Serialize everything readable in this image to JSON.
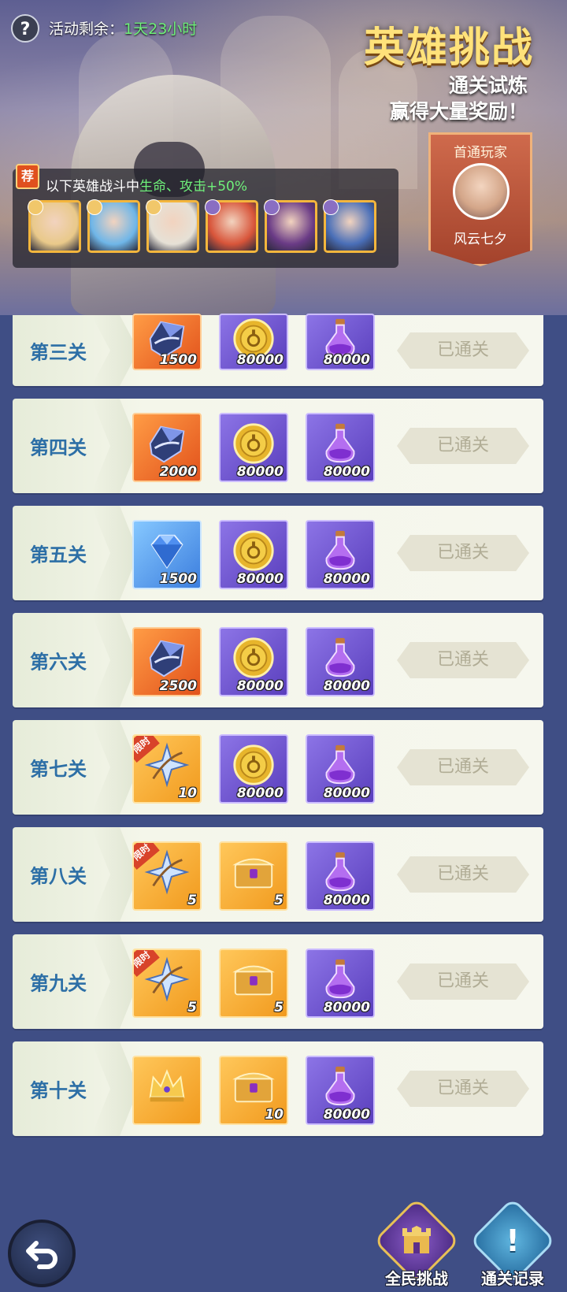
{
  "header": {
    "help_symbol": "?",
    "timer_label": "活动剩余：",
    "timer_value": "1天23小时",
    "title": "英雄挑战",
    "subtitle_line1": "通关试炼",
    "subtitle_line2": "赢得大量奖励！"
  },
  "first_clear": {
    "title": "首通玩家",
    "player_name": "风云七夕"
  },
  "buff": {
    "tag": "荐",
    "text_prefix": "以下英雄战斗中",
    "text_stat": "生命、攻击+50%",
    "heroes": [
      {
        "name": "hero-portrait-1",
        "tone": "#e9c98a"
      },
      {
        "name": "hero-portrait-2",
        "tone": "#6fb6e8"
      },
      {
        "name": "hero-portrait-3",
        "tone": "#e6e1d6"
      },
      {
        "name": "hero-portrait-4",
        "tone": "#d8553a"
      },
      {
        "name": "hero-portrait-5",
        "tone": "#6a3b86"
      },
      {
        "name": "hero-portrait-6",
        "tone": "#4a6fb8"
      }
    ]
  },
  "stages": [
    {
      "name": "第三关",
      "status": "已通关",
      "rewards": [
        {
          "kind": "crystal",
          "bg": "orange",
          "count": "1500"
        },
        {
          "kind": "coin",
          "bg": "purple",
          "count": "80000"
        },
        {
          "kind": "potion",
          "bg": "purple",
          "count": "80000"
        }
      ]
    },
    {
      "name": "第四关",
      "status": "已通关",
      "rewards": [
        {
          "kind": "crystal",
          "bg": "orange",
          "count": "2000"
        },
        {
          "kind": "coin",
          "bg": "purple",
          "count": "80000"
        },
        {
          "kind": "potion",
          "bg": "purple",
          "count": "80000"
        }
      ]
    },
    {
      "name": "第五关",
      "status": "已通关",
      "rewards": [
        {
          "kind": "diamond",
          "bg": "blue",
          "count": "1500"
        },
        {
          "kind": "coin",
          "bg": "purple",
          "count": "80000"
        },
        {
          "kind": "potion",
          "bg": "purple",
          "count": "80000"
        }
      ]
    },
    {
      "name": "第六关",
      "status": "已通关",
      "rewards": [
        {
          "kind": "crystal",
          "bg": "orange",
          "count": "2500"
        },
        {
          "kind": "coin",
          "bg": "purple",
          "count": "80000"
        },
        {
          "kind": "potion",
          "bg": "purple",
          "count": "80000"
        }
      ]
    },
    {
      "name": "第七关",
      "status": "已通关",
      "rewards": [
        {
          "kind": "star-weapon",
          "bg": "gold",
          "count": "10",
          "limited": "限时"
        },
        {
          "kind": "coin",
          "bg": "purple",
          "count": "80000"
        },
        {
          "kind": "potion",
          "bg": "purple",
          "count": "80000"
        }
      ]
    },
    {
      "name": "第八关",
      "status": "已通关",
      "rewards": [
        {
          "kind": "star-weapon",
          "bg": "gold",
          "count": "5",
          "limited": "限时"
        },
        {
          "kind": "chest",
          "bg": "gold",
          "count": "5"
        },
        {
          "kind": "potion",
          "bg": "purple",
          "count": "80000"
        }
      ]
    },
    {
      "name": "第九关",
      "status": "已通关",
      "rewards": [
        {
          "kind": "star-weapon",
          "bg": "gold",
          "count": "5",
          "limited": "限时"
        },
        {
          "kind": "chest",
          "bg": "gold",
          "count": "5"
        },
        {
          "kind": "potion",
          "bg": "purple",
          "count": "80000"
        }
      ]
    },
    {
      "name": "第十关",
      "status": "已通关",
      "rewards": [
        {
          "kind": "crown",
          "bg": "gold",
          "count": ""
        },
        {
          "kind": "chest",
          "bg": "gold",
          "count": "10"
        },
        {
          "kind": "potion",
          "bg": "purple",
          "count": "80000"
        }
      ]
    }
  ],
  "footer": {
    "challenge_label": "全民挑战",
    "record_label": "通关记录",
    "record_symbol": "!"
  },
  "colors": {
    "stage_name": "#2d6fa6",
    "timer_value": "#6ff07a",
    "title": "#ffe27a"
  }
}
